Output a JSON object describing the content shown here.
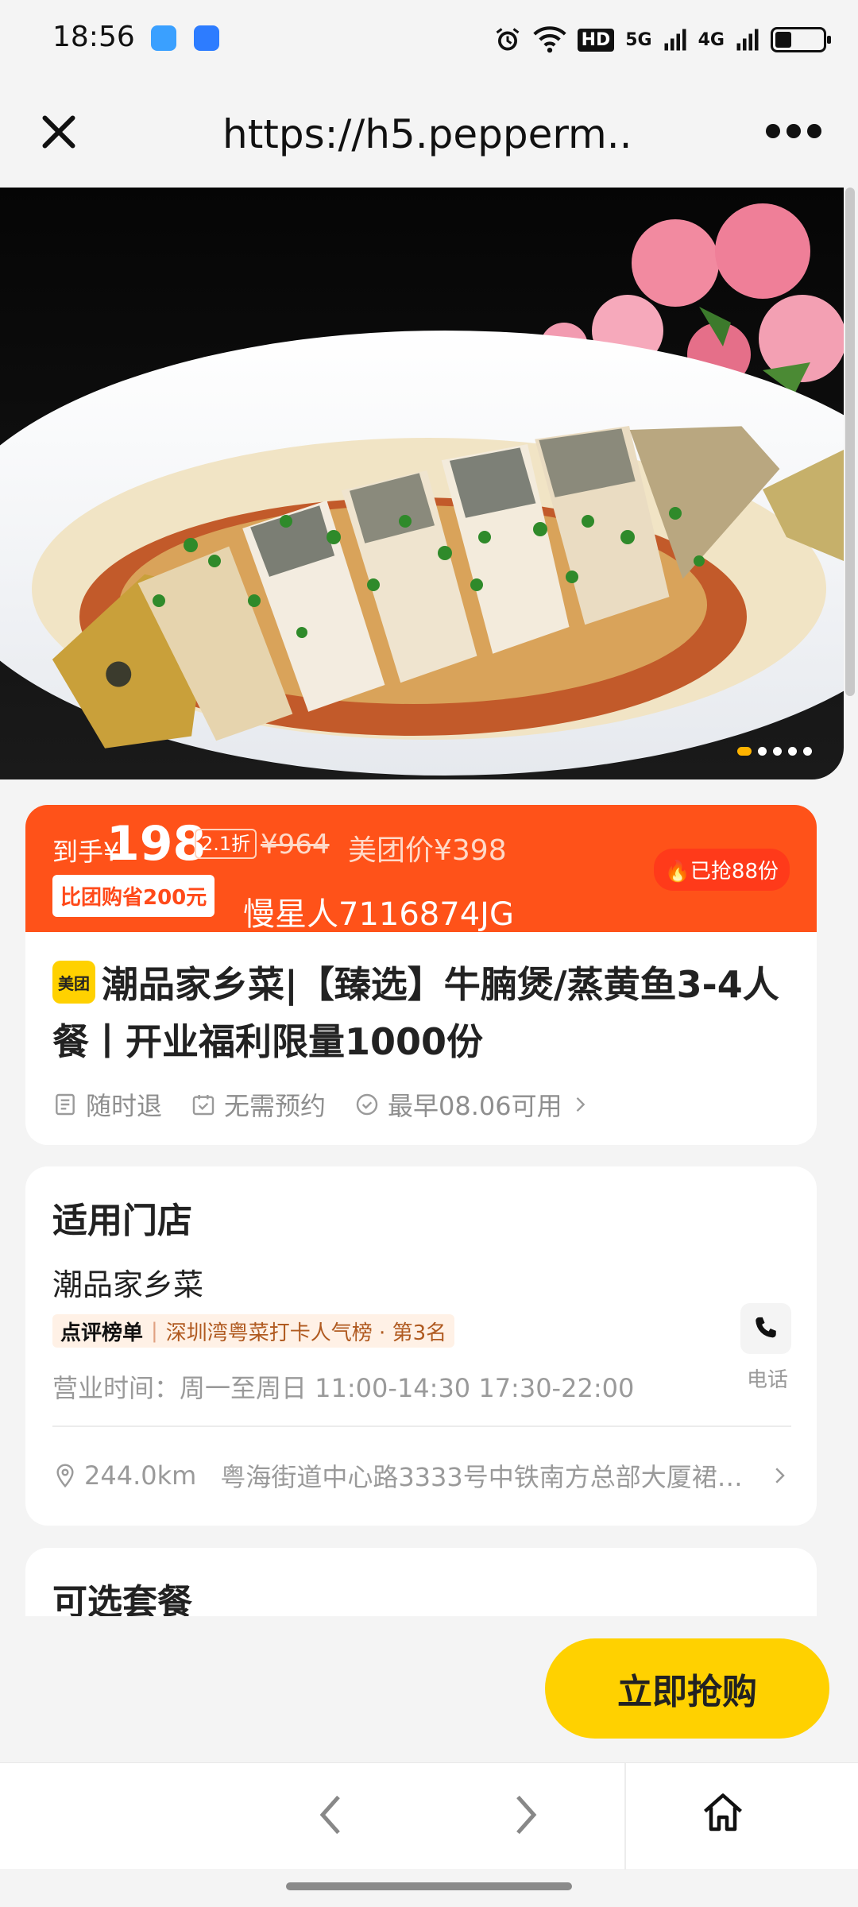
{
  "status_bar": {
    "time": "18:56",
    "wifi_icon": "wifi-icon",
    "hd_label": "HD",
    "sim1_label": "5G",
    "sim2_label": "4G",
    "battery_level_fraction": 0.35
  },
  "browser": {
    "url": "https://h5.pepperm...",
    "close_icon": "close-icon",
    "more_icon": "more-icon"
  },
  "hero": {
    "image_icon": "food-photo",
    "total_slides": 5,
    "active_slide": 1
  },
  "price": {
    "label": "到手¥",
    "value": "198",
    "discount": "2.1折",
    "original": "¥964",
    "meituan_price": "美团价¥398",
    "save_badge": "比团购省200元",
    "grabbed": "已抢88份",
    "watermark": "慢星人7116874JG"
  },
  "product": {
    "brand_badge": "美团",
    "title": "潮品家乡菜|【臻选】牛腩煲/蒸黄鱼3-4人餐丨开业福利限量1000份",
    "features": [
      {
        "label": "随时退",
        "icon": "document-icon"
      },
      {
        "label": "无需预约",
        "icon": "calendar-check-icon"
      },
      {
        "label": "最早08.06可用",
        "icon": "check-circle-icon"
      }
    ]
  },
  "store": {
    "section_title": "适用门店",
    "name": "潮品家乡菜",
    "rank_label": "点评榜单",
    "rank_desc": "深圳湾粤菜打卡人气榜 · 第3名",
    "hours": "营业时间：周一至周日 11:00-14:30 17:30-22:00",
    "phone_label": "电话",
    "distance": "244.0km",
    "address": "粤海街道中心路3333号中铁南方总部大厦裙楼..."
  },
  "combos": {
    "section_title": "可选套餐"
  },
  "actions": {
    "buy_label": "立即抢购"
  },
  "colors": {
    "accent_orange": "#ff5219",
    "brand_yellow": "#ffd100"
  }
}
